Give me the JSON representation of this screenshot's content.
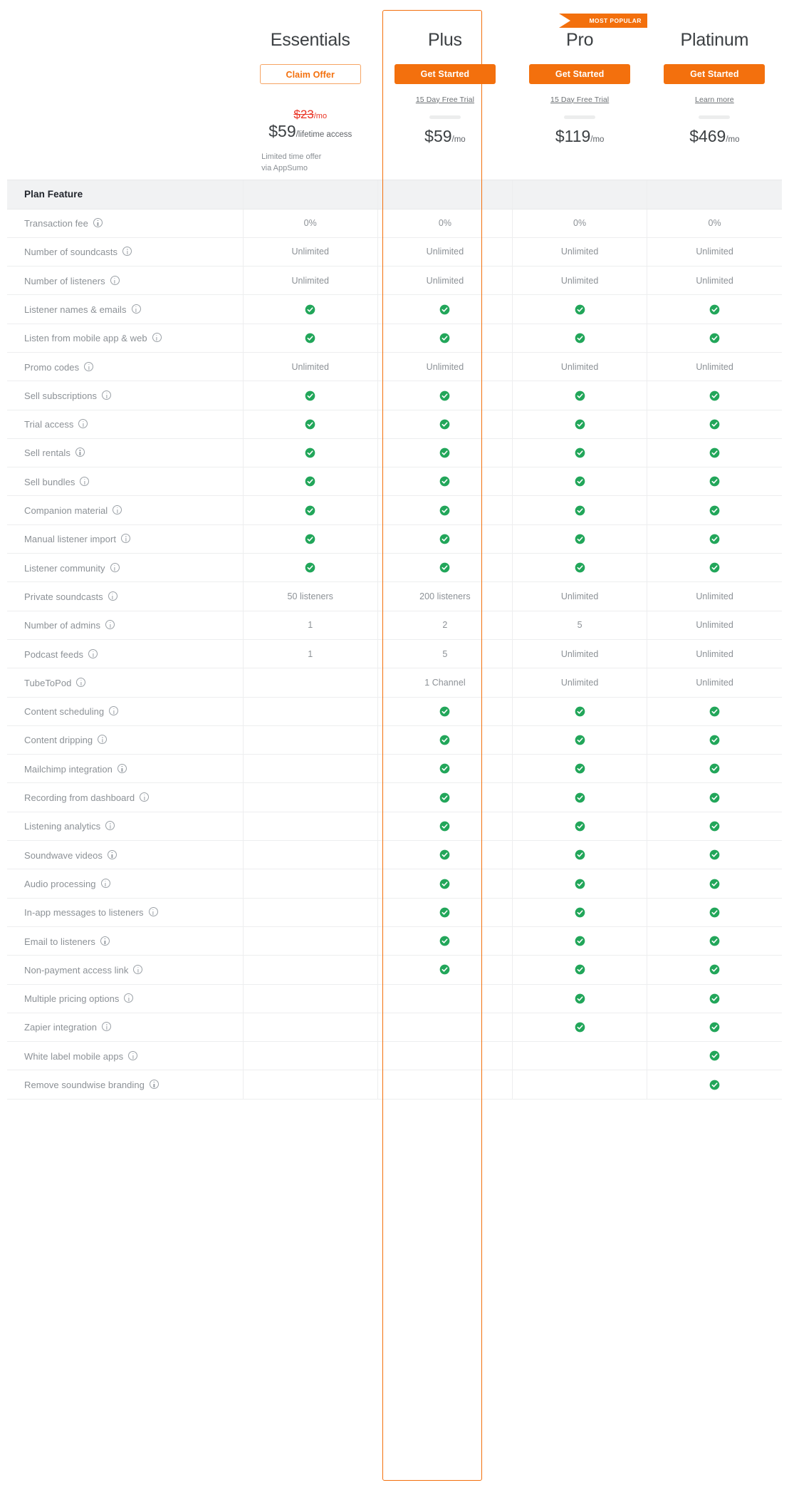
{
  "colors": {
    "accent": "#f3700d",
    "check_green": "#22a65a",
    "old_price_red": "#ea3323",
    "feature_text": "#8c9196",
    "heading_text": "#3c4043"
  },
  "section": {
    "title": "Plan Feature"
  },
  "ribbon": {
    "label": "MOST POPULAR"
  },
  "plans": [
    {
      "name": "Essentials",
      "cta_label": "Claim Offer",
      "cta_style": "outline",
      "sub_link": "",
      "has_rule": false,
      "old_price_amount": "$23",
      "old_price_period": "/mo",
      "price_amount": "$59",
      "price_period": "/lifetime access",
      "note_line1": "Limited time offer",
      "note_line2": "via AppSumo",
      "highlighted": false
    },
    {
      "name": "Plus",
      "cta_label": "Get Started",
      "cta_style": "solid",
      "sub_link": "15 Day Free Trial",
      "has_rule": true,
      "old_price_amount": "",
      "old_price_period": "",
      "price_amount": "$59",
      "price_period": "/mo",
      "note_line1": "",
      "note_line2": "",
      "highlighted": false
    },
    {
      "name": "Pro",
      "cta_label": "Get Started",
      "cta_style": "solid",
      "sub_link": "15 Day Free Trial",
      "has_rule": true,
      "old_price_amount": "",
      "old_price_period": "",
      "price_amount": "$119",
      "price_period": "/mo",
      "note_line1": "",
      "note_line2": "",
      "highlighted": true
    },
    {
      "name": "Platinum",
      "cta_label": "Get Started",
      "cta_style": "solid",
      "sub_link": "Learn more",
      "has_rule": true,
      "old_price_amount": "",
      "old_price_period": "",
      "price_amount": "$469",
      "price_period": "/mo",
      "note_line1": "",
      "note_line2": "",
      "highlighted": false
    }
  ],
  "features": [
    {
      "label": "Transaction fee",
      "values": [
        "0%",
        "0%",
        "0%",
        "0%"
      ]
    },
    {
      "label": "Number of soundcasts",
      "values": [
        "Unlimited",
        "Unlimited",
        "Unlimited",
        "Unlimited"
      ]
    },
    {
      "label": "Number of listeners",
      "values": [
        "Unlimited",
        "Unlimited",
        "Unlimited",
        "Unlimited"
      ]
    },
    {
      "label": "Listener names & emails",
      "values": [
        "check",
        "check",
        "check",
        "check"
      ]
    },
    {
      "label": "Listen from mobile app & web",
      "values": [
        "check",
        "check",
        "check",
        "check"
      ]
    },
    {
      "label": "Promo codes",
      "values": [
        "Unlimited",
        "Unlimited",
        "Unlimited",
        "Unlimited"
      ]
    },
    {
      "label": "Sell subscriptions",
      "values": [
        "check",
        "check",
        "check",
        "check"
      ]
    },
    {
      "label": "Trial access",
      "values": [
        "check",
        "check",
        "check",
        "check"
      ]
    },
    {
      "label": "Sell rentals",
      "values": [
        "check",
        "check",
        "check",
        "check"
      ]
    },
    {
      "label": "Sell bundles",
      "values": [
        "check",
        "check",
        "check",
        "check"
      ]
    },
    {
      "label": "Companion material",
      "values": [
        "check",
        "check",
        "check",
        "check"
      ]
    },
    {
      "label": "Manual listener import",
      "values": [
        "check",
        "check",
        "check",
        "check"
      ]
    },
    {
      "label": "Listener community",
      "values": [
        "check",
        "check",
        "check",
        "check"
      ]
    },
    {
      "label": "Private soundcasts",
      "values": [
        "50 listeners",
        "200 listeners",
        "Unlimited",
        "Unlimited"
      ]
    },
    {
      "label": "Number of admins",
      "values": [
        "1",
        "2",
        "5",
        "Unlimited"
      ]
    },
    {
      "label": "Podcast feeds",
      "values": [
        "1",
        "5",
        "Unlimited",
        "Unlimited"
      ]
    },
    {
      "label": "TubeToPod",
      "values": [
        "",
        "1 Channel",
        "Unlimited",
        "Unlimited"
      ]
    },
    {
      "label": "Content scheduling",
      "values": [
        "",
        "check",
        "check",
        "check"
      ]
    },
    {
      "label": "Content dripping",
      "values": [
        "",
        "check",
        "check",
        "check"
      ]
    },
    {
      "label": "Mailchimp integration",
      "values": [
        "",
        "check",
        "check",
        "check"
      ]
    },
    {
      "label": "Recording from dashboard",
      "values": [
        "",
        "check",
        "check",
        "check"
      ]
    },
    {
      "label": "Listening analytics",
      "values": [
        "",
        "check",
        "check",
        "check"
      ]
    },
    {
      "label": "Soundwave videos",
      "values": [
        "",
        "check",
        "check",
        "check"
      ]
    },
    {
      "label": "Audio processing",
      "values": [
        "",
        "check",
        "check",
        "check"
      ]
    },
    {
      "label": "In-app messages to listeners",
      "values": [
        "",
        "check",
        "check",
        "check"
      ]
    },
    {
      "label": "Email to listeners",
      "values": [
        "",
        "check",
        "check",
        "check"
      ]
    },
    {
      "label": "Non-payment access link",
      "values": [
        "",
        "check",
        "check",
        "check"
      ]
    },
    {
      "label": "Multiple pricing options",
      "values": [
        "",
        "",
        "check",
        "check"
      ]
    },
    {
      "label": "Zapier integration",
      "values": [
        "",
        "",
        "check",
        "check"
      ]
    },
    {
      "label": "White label mobile apps",
      "values": [
        "",
        "",
        "",
        "check"
      ]
    },
    {
      "label": "Remove soundwise branding",
      "values": [
        "",
        "",
        "",
        "check"
      ]
    }
  ]
}
